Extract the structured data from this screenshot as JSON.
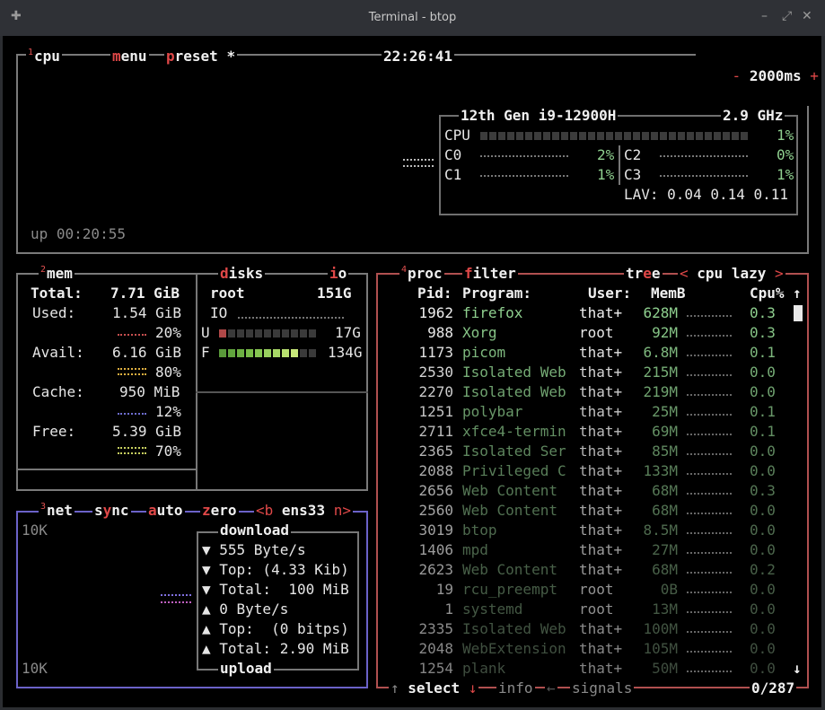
{
  "window": {
    "title": "Terminal - btop"
  },
  "cpu": {
    "num": "1",
    "label": "cpu",
    "menu": "menu",
    "preset": "preset *",
    "clock": "22:26:41",
    "minus": "-",
    "interval": "2000ms",
    "plus": "+",
    "uptime": "up 00:20:55",
    "model": "12th Gen i9-12900H",
    "freq": "2.9 GHz",
    "total_label": "CPU",
    "total_pct": "1%",
    "cores": [
      {
        "name": "C0",
        "pct": "2%"
      },
      {
        "name": "C2",
        "pct": "0%"
      },
      {
        "name": "C1",
        "pct": "1%"
      },
      {
        "name": "C3",
        "pct": "1%"
      }
    ],
    "lav": "LAV: 0.04 0.14 0.11"
  },
  "mem": {
    "num": "2",
    "label": "mem",
    "rows": [
      {
        "k": "Total:",
        "v": "7.71 GiB"
      },
      {
        "k": "Used:",
        "v": "1.54 GiB",
        "p": "20%"
      },
      {
        "k": "Avail:",
        "v": "6.16 GiB",
        "p": "80%"
      },
      {
        "k": "Cache:",
        "v": "950 MiB",
        "p": "12%"
      },
      {
        "k": "Free:",
        "v": "5.39 GiB",
        "p": "70%"
      }
    ]
  },
  "disks": {
    "label": "disks",
    "io": "io",
    "root": "root",
    "root_size": "151G",
    "io_label": "IO",
    "used_label": "U",
    "used_size": "17G",
    "used_frac": 0.1,
    "free_label": "F",
    "free_size": "134G",
    "free_frac": 0.9
  },
  "net": {
    "num": "3",
    "label": "net",
    "sync": "sync",
    "auto": "auto",
    "zero": "zero",
    "b": "<b",
    "iface": "ens33",
    "n": "n>",
    "scale_top": "10K",
    "scale_bottom": "10K",
    "download": "download",
    "upload": "upload",
    "stats": [
      "▼ 555 Byte/s",
      "▼ Top: (4.33 Kib)",
      "▼ Total:  100 MiB",
      "▲ 0 Byte/s",
      "▲ Top:  (0 bitps)",
      "▲ Total: 2.90 MiB"
    ]
  },
  "proc": {
    "num": "4",
    "label": "proc",
    "filter": "filter",
    "tree": "tree",
    "sort_left": "<",
    "sort": "cpu lazy",
    "sort_right": ">",
    "headers": {
      "pid": "Pid:",
      "program": "Program:",
      "user": "User:",
      "mem": "MemB",
      "cpu": "Cpu%"
    },
    "up_arrow": "↑",
    "down_arrow": "↓",
    "rows": [
      {
        "pid": "1962",
        "program": "firefox",
        "user": "that+",
        "mem": "628M",
        "cpu": "0.3"
      },
      {
        "pid": "988",
        "program": "Xorg",
        "user": "root",
        "mem": "92M",
        "cpu": "0.3"
      },
      {
        "pid": "1173",
        "program": "picom",
        "user": "that+",
        "mem": "6.8M",
        "cpu": "0.1"
      },
      {
        "pid": "2530",
        "program": "Isolated Web",
        "user": "that+",
        "mem": "215M",
        "cpu": "0.0"
      },
      {
        "pid": "2270",
        "program": "Isolated Web",
        "user": "that+",
        "mem": "219M",
        "cpu": "0.0"
      },
      {
        "pid": "1251",
        "program": "polybar",
        "user": "that+",
        "mem": "25M",
        "cpu": "0.1"
      },
      {
        "pid": "2711",
        "program": "xfce4-termin",
        "user": "that+",
        "mem": "69M",
        "cpu": "0.1"
      },
      {
        "pid": "2365",
        "program": "Isolated Ser",
        "user": "that+",
        "mem": "85M",
        "cpu": "0.0"
      },
      {
        "pid": "2088",
        "program": "Privileged C",
        "user": "that+",
        "mem": "133M",
        "cpu": "0.0"
      },
      {
        "pid": "2656",
        "program": "Web Content",
        "user": "that+",
        "mem": "68M",
        "cpu": "0.3"
      },
      {
        "pid": "2560",
        "program": "Web Content",
        "user": "that+",
        "mem": "68M",
        "cpu": "0.0"
      },
      {
        "pid": "3019",
        "program": "btop",
        "user": "that+",
        "mem": "8.5M",
        "cpu": "0.0"
      },
      {
        "pid": "1406",
        "program": "mpd",
        "user": "that+",
        "mem": "27M",
        "cpu": "0.0"
      },
      {
        "pid": "2623",
        "program": "Web Content",
        "user": "that+",
        "mem": "68M",
        "cpu": "0.2"
      },
      {
        "pid": "19",
        "program": "rcu_preempt",
        "user": "root",
        "mem": "0B",
        "cpu": "0.0"
      },
      {
        "pid": "1",
        "program": "systemd",
        "user": "root",
        "mem": "13M",
        "cpu": "0.0"
      },
      {
        "pid": "2335",
        "program": "Isolated Web",
        "user": "that+",
        "mem": "100M",
        "cpu": "0.0"
      },
      {
        "pid": "2048",
        "program": "WebExtension",
        "user": "that+",
        "mem": "105M",
        "cpu": "0.0"
      },
      {
        "pid": "1254",
        "program": "plank",
        "user": "that+",
        "mem": "50M",
        "cpu": "0.0"
      }
    ],
    "footer": {
      "up": "↑",
      "select": "select",
      "down": "↓",
      "info": "info",
      "left": "←",
      "signals": "signals",
      "count": "0/287"
    }
  },
  "colors": {
    "cpu_border": "#777777",
    "net_border": "#6b62c8",
    "proc_border": "#b05050",
    "accent_red": "#e04848",
    "green": "#8fd08f"
  }
}
